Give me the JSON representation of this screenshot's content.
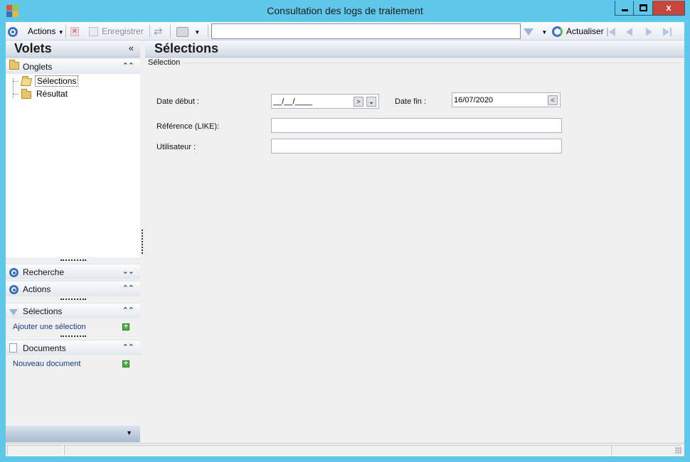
{
  "window": {
    "title": "Consultation des logs de traitement",
    "close_glyph": "x"
  },
  "toolbar": {
    "actions_label": "Actions",
    "save_label": "Enregistrer",
    "search_value": "",
    "refresh_label": "Actualiser"
  },
  "leftpane": {
    "title": "Volets",
    "collapse_glyph": "«",
    "onglets": {
      "label": "Onglets",
      "items": [
        {
          "label": "Sélections",
          "selected": true
        },
        {
          "label": "Résultat",
          "selected": false
        }
      ]
    },
    "recherche_label": "Recherche",
    "actions_label": "Actions",
    "selections": {
      "label": "Sélections",
      "link": "Ajouter une sélection"
    },
    "documents": {
      "label": "Documents",
      "link": "Nouveau document"
    }
  },
  "main": {
    "title": "Sélections",
    "group_label": "Sélection",
    "fields": {
      "date_debut_label": "Date début :",
      "date_debut_value": "__/__/____",
      "date_fin_label": "Date fin :",
      "date_fin_value": "16/07/2020",
      "reference_label": "Référence (LIKE):",
      "reference_value": "",
      "utilisateur_label": "Utilisateur :",
      "utilisateur_value": ""
    }
  },
  "colors": {
    "window_frame": "#5ec7ea",
    "close_button": "#c7463b",
    "accent_blue": "#3c6fbf",
    "link": "#1a3b8a"
  },
  "icons": {
    "actions": "circle-target-icon",
    "delete": "delete-x-icon",
    "save": "save-document-icon",
    "sync": "sync-arrows-icon",
    "print": "printer-icon",
    "filter": "funnel-icon",
    "refresh": "refresh-circle-icon",
    "nav": [
      "first-page-icon",
      "previous-page-icon",
      "next-page-icon",
      "last-page-icon"
    ]
  }
}
